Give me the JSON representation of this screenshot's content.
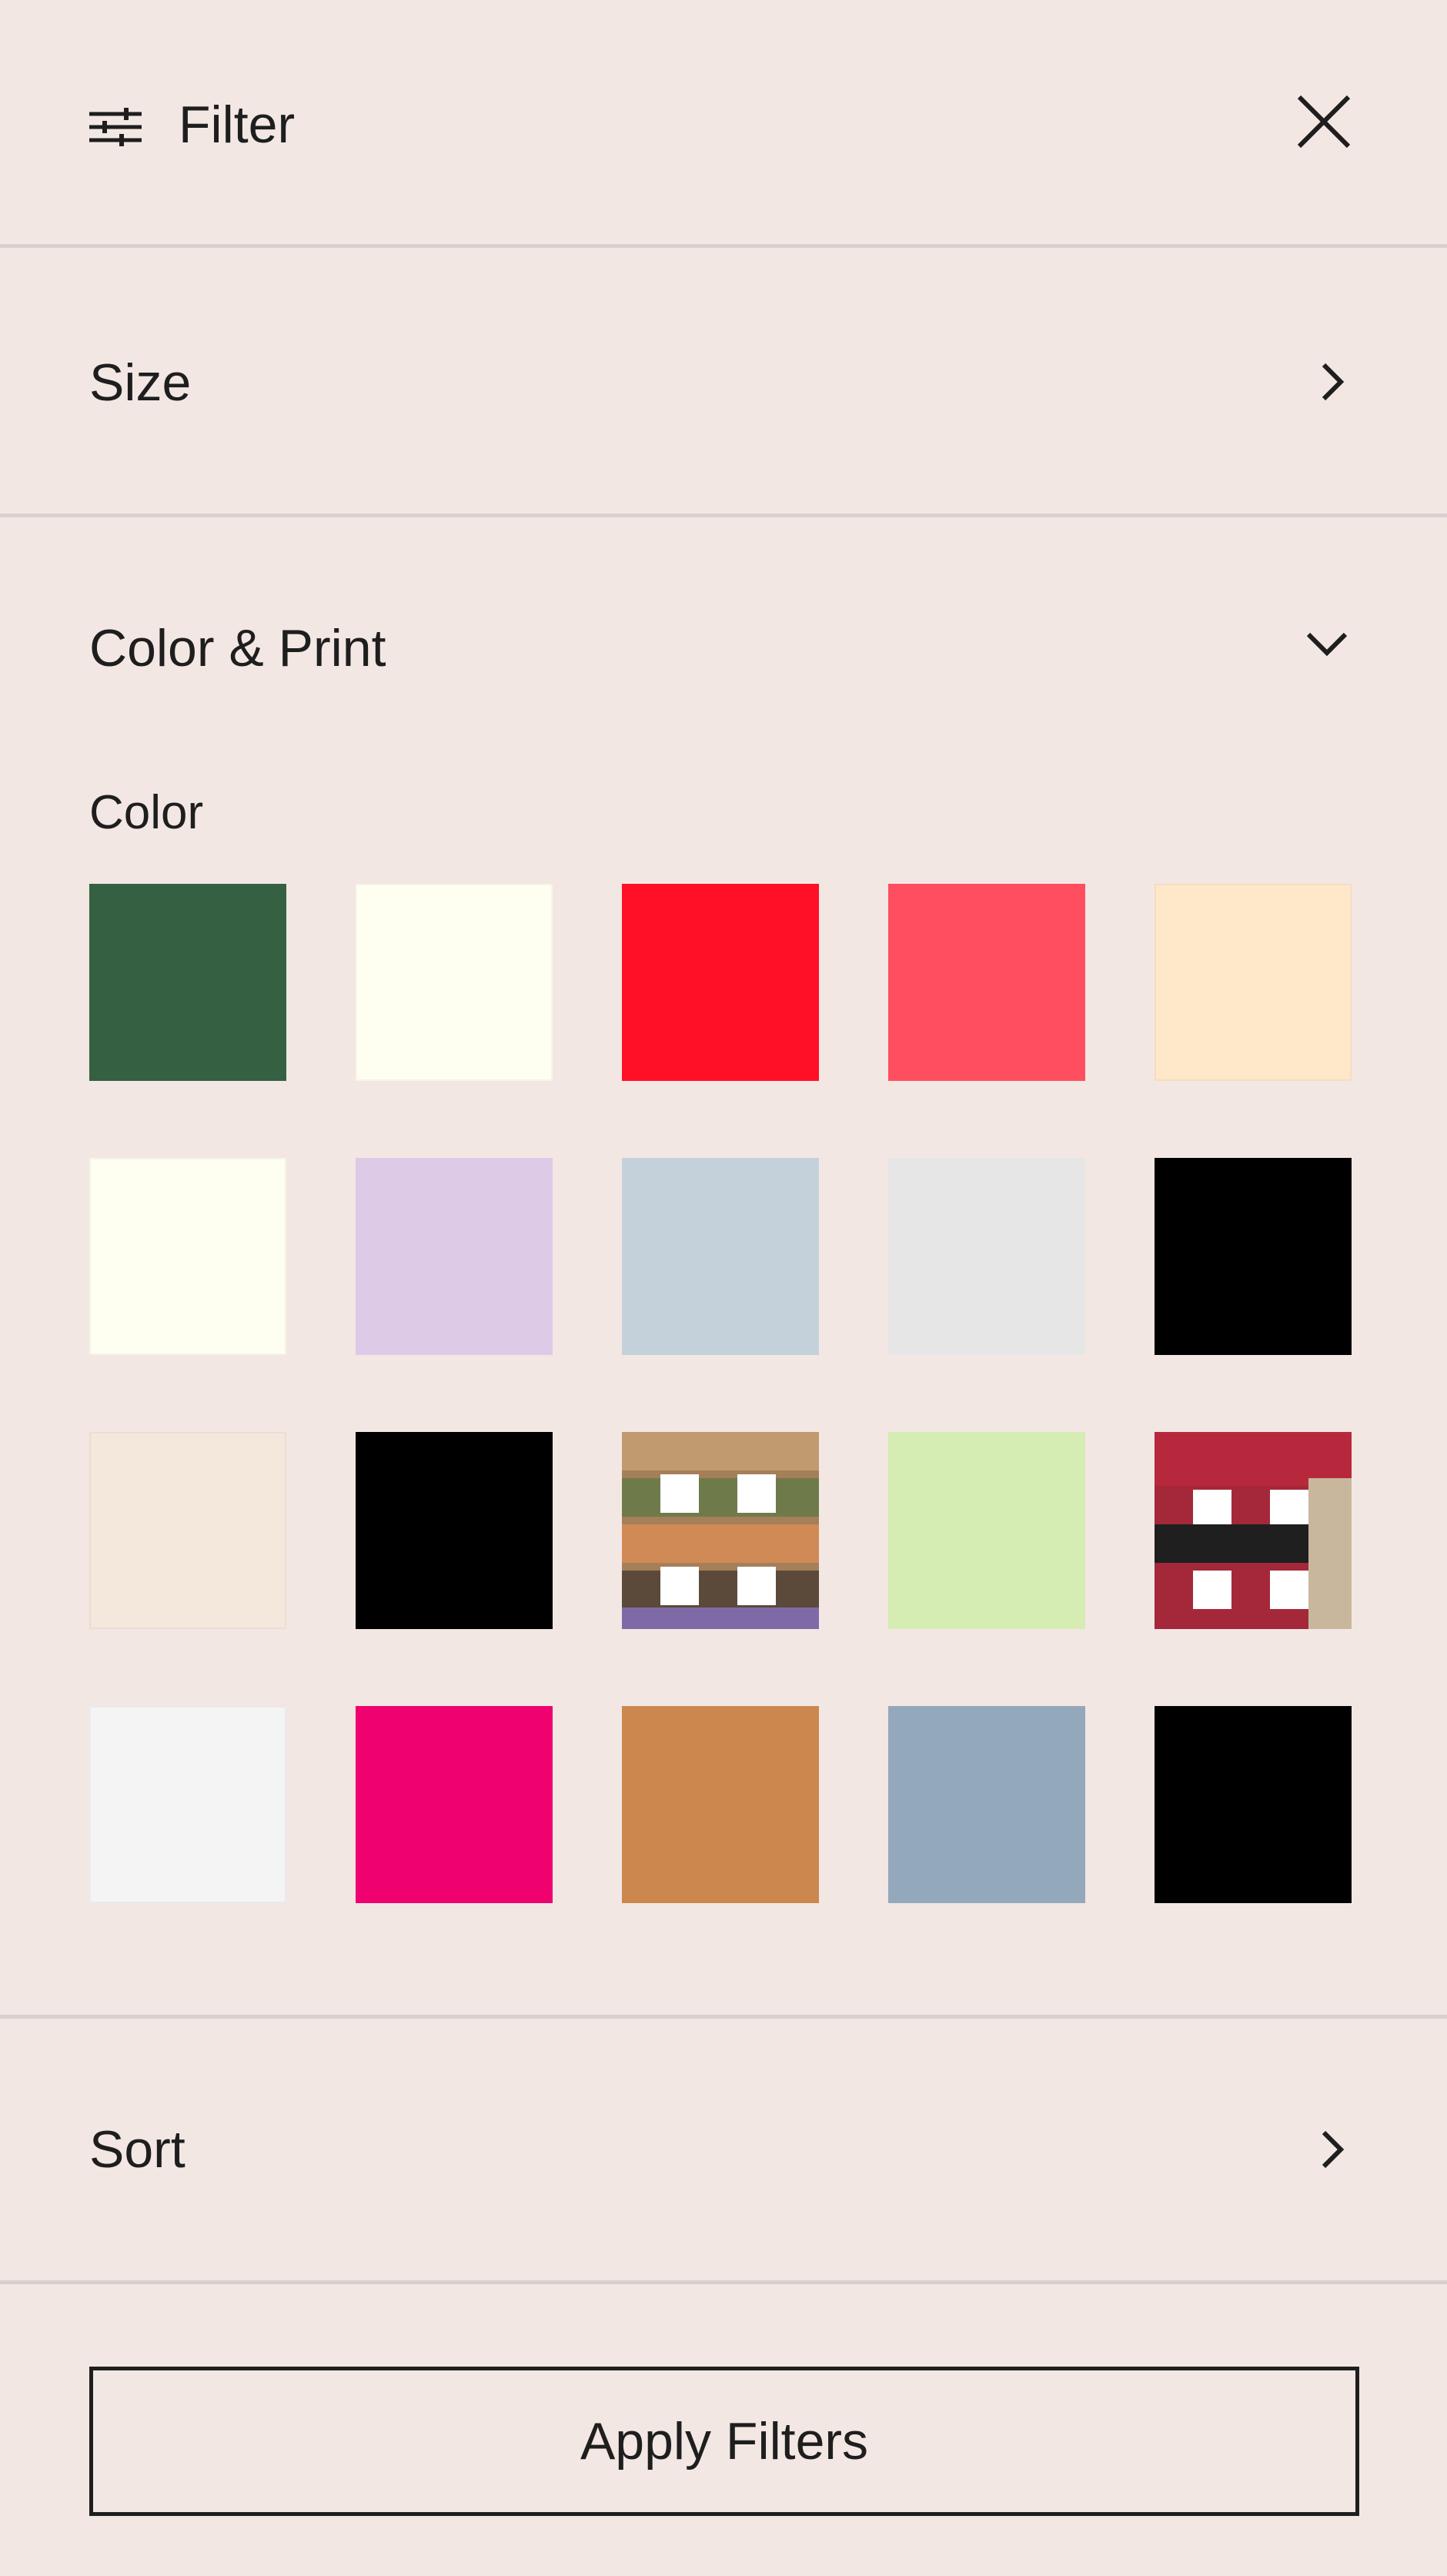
{
  "header": {
    "title": "Filter"
  },
  "rows": {
    "size": "Size",
    "color_print": "Color & Print",
    "sort": "Sort"
  },
  "color_section": {
    "label": "Color",
    "swatches": [
      {
        "name": "dark-green",
        "color": "#356042"
      },
      {
        "name": "ivory",
        "color": "#fffff1"
      },
      {
        "name": "red",
        "color": "#ff1027"
      },
      {
        "name": "coral",
        "color": "#ff4e5f"
      },
      {
        "name": "peach",
        "color": "#ffe7ca"
      },
      {
        "name": "cream",
        "color": "#fffff1"
      },
      {
        "name": "lavender",
        "color": "#dccae7"
      },
      {
        "name": "light-blue",
        "color": "#c4d1db"
      },
      {
        "name": "marble",
        "color": "#e7e6e6"
      },
      {
        "name": "black",
        "color": "#000000"
      },
      {
        "name": "beige",
        "color": "#f4e8dc"
      },
      {
        "name": "black-2",
        "color": "#000000"
      },
      {
        "name": "knit-pattern-multi",
        "color": "pattern"
      },
      {
        "name": "light-green",
        "color": "#d5ecb2"
      },
      {
        "name": "knit-pattern-red",
        "color": "pattern"
      },
      {
        "name": "white",
        "color": "#f4f4f5"
      },
      {
        "name": "magenta",
        "color": "#ef0170"
      },
      {
        "name": "camel",
        "color": "#cb874e"
      },
      {
        "name": "slate-blue",
        "color": "#94a8bb"
      },
      {
        "name": "black-3",
        "color": "#000000"
      }
    ]
  },
  "footer": {
    "apply_label": "Apply Filters"
  },
  "colors": {
    "background": "#f3e7e4",
    "divider": "#d8d0cf",
    "text": "#1e1e1e"
  }
}
